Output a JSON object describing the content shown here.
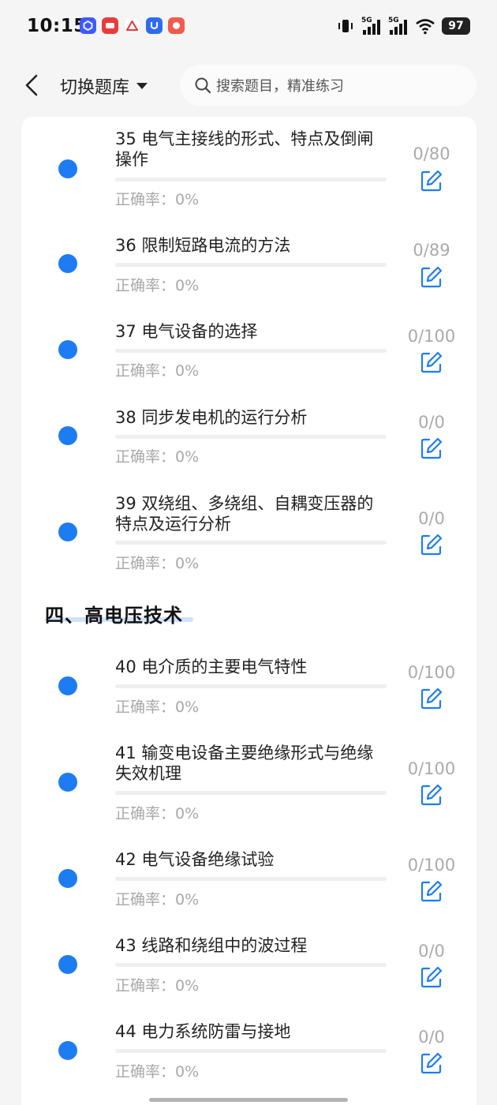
{
  "status_bar": {
    "time": "10:15",
    "network_labels": [
      "5G",
      "5G"
    ],
    "battery": "97",
    "app_icons": [
      "app-icon-blue",
      "app-icon-red",
      "app-icon-bank",
      "app-icon-blue-u",
      "app-icon-red-pig"
    ]
  },
  "header": {
    "switch_bank_label": "切换题库",
    "search_placeholder": "搜索题目，精准练习"
  },
  "section": {
    "title": "四、高电压技术"
  },
  "items": [
    {
      "title": "35 电气主接线的形式、特点及倒闸操作",
      "accuracy": "正确率：0%",
      "count": "0/80",
      "progress": 0
    },
    {
      "title": "36 限制短路电流的方法",
      "accuracy": "正确率：0%",
      "count": "0/89",
      "progress": 0
    },
    {
      "title": "37 电气设备的选择",
      "accuracy": "正确率：0%",
      "count": "0/100",
      "progress": 0
    },
    {
      "title": "38 同步发电机的运行分析",
      "accuracy": "正确率：0%",
      "count": "0/0",
      "progress": 0
    },
    {
      "title": "39 双绕组、多绕组、自耦变压器的特点及运行分析",
      "accuracy": "正确率：0%",
      "count": "0/0",
      "progress": 0
    },
    {
      "title": "40 电介质的主要电气特性",
      "accuracy": "正确率：0%",
      "count": "0/100",
      "progress": 0
    },
    {
      "title": "41 输变电设备主要绝缘形式与绝缘失效机理",
      "accuracy": "正确率：0%",
      "count": "0/100",
      "progress": 0
    },
    {
      "title": "42 电气设备绝缘试验",
      "accuracy": "正确率：0%",
      "count": "0/100",
      "progress": 0
    },
    {
      "title": "43 线路和绕组中的波过程",
      "accuracy": "正确率：0%",
      "count": "0/0",
      "progress": 0
    },
    {
      "title": "44 电力系统防雷与接地",
      "accuracy": "正确率：0%",
      "count": "0/0",
      "progress": 0
    }
  ],
  "colors": {
    "accent": "#1e7cf2",
    "muted_text": "#a8a8a8",
    "track": "#efefef"
  }
}
